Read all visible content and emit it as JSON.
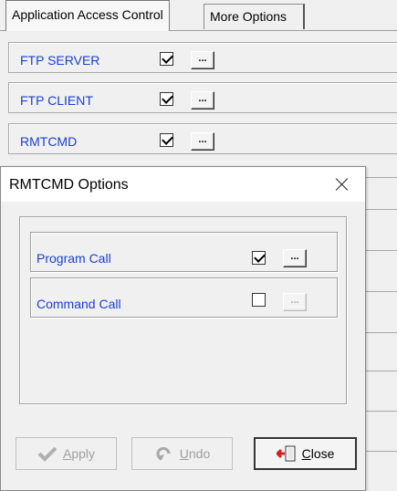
{
  "tabs": [
    {
      "label": "Application Access Control",
      "active": true
    },
    {
      "label": "More Options",
      "active": false
    }
  ],
  "applications": [
    {
      "label": "FTP SERVER",
      "checked": true,
      "dots": "..."
    },
    {
      "label": "FTP CLIENT",
      "checked": true,
      "dots": "..."
    },
    {
      "label": "RMTCMD",
      "checked": true,
      "dots": "..."
    }
  ],
  "dialog": {
    "title": "RMTCMD Options",
    "options": [
      {
        "label": "Program Call",
        "checked": true,
        "dots": "...",
        "enabled": true
      },
      {
        "label": "Command Call",
        "checked": false,
        "dots": "...",
        "enabled": false
      }
    ],
    "buttons": {
      "apply": {
        "mnemonic": "A",
        "rest": "pply",
        "enabled": false
      },
      "undo": {
        "mnemonic": "U",
        "rest": "ndo",
        "enabled": false
      },
      "close": {
        "mnemonic": "C",
        "rest": "lose",
        "enabled": true
      }
    }
  },
  "colors": {
    "label_blue": "#1a3fcf",
    "disabled_text": "#a0a0a0",
    "exit_icon_red": "#d02020"
  },
  "icons": {
    "apply": "checkmark-icon",
    "undo": "undo-arrow-icon",
    "close": "exit-door-icon"
  }
}
